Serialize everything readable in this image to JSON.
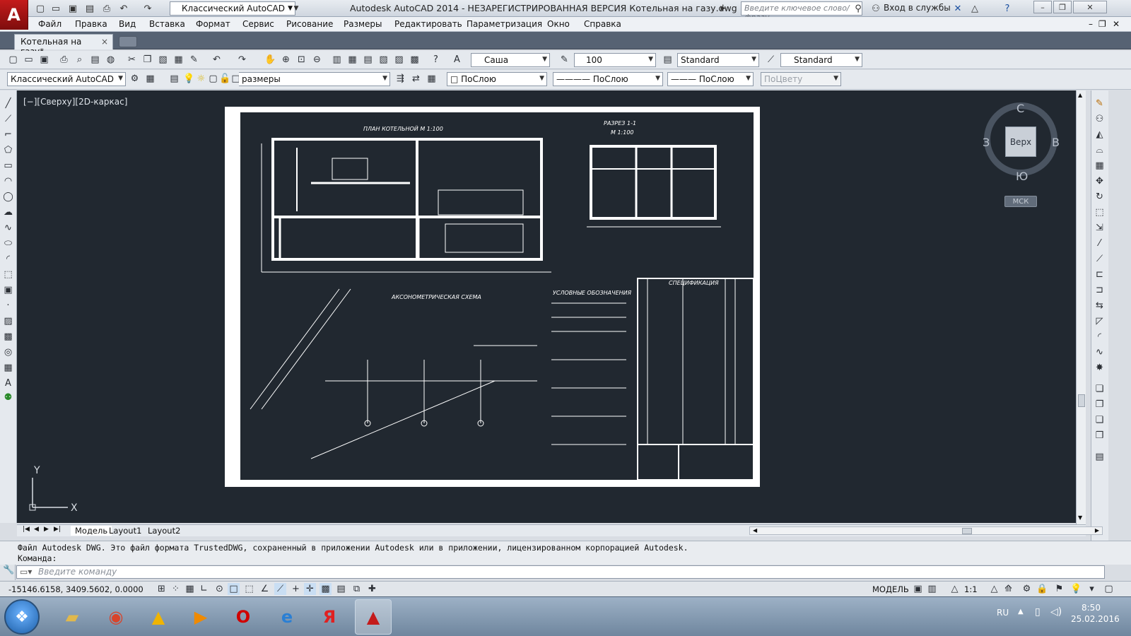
{
  "app": {
    "logo_letter": "A",
    "window_title": "Autodesk AutoCAD 2014 - НЕЗАРЕГИСТРИРОВАННАЯ ВЕРСИЯ    Котельная на газу.dwg",
    "workspace": "Классический AutoCAD",
    "search_placeholder": "Введите ключевое слово/фразу",
    "login": "Вход в службы"
  },
  "menus": [
    "Файл",
    "Правка",
    "Вид",
    "Вставка",
    "Формат",
    "Сервис",
    "Рисование",
    "Размеры",
    "Редактировать",
    "Параметризация",
    "Окно",
    "Справка"
  ],
  "doc_tab": {
    "label": "Котельная на газу*",
    "close": "×"
  },
  "toolbar1": {
    "text_style": "Саша",
    "dim_value": "100",
    "dim_style": "Standard",
    "table_style": "Standard"
  },
  "toolbar2": {
    "workspace": "Классический AutoCAD",
    "layer": "размеры",
    "color": "ПоСлою",
    "linetype": "ПоСлою",
    "lineweight": "ПоСлою",
    "plotstyle": "ПоЦвету"
  },
  "viewport": {
    "label": "[−][Сверху][2D-каркас]",
    "cube_face": "Верх",
    "north": "С",
    "east": "В",
    "south": "Ю",
    "west": "З",
    "ucs_button": "МСК",
    "axis_y": "Y",
    "axis_x": "X"
  },
  "drawing": {
    "plan_title": "ПЛАН КОТЕЛЬНОЙ   М 1:100",
    "section_title": "РАЗРЕЗ 1-1",
    "section_scale": "М 1:100",
    "axo_title": "АКСОНОМЕТРИЧЕСКАЯ СХЕМА",
    "legend_title": "УСЛОВНЫЕ ОБОЗНАЧЕНИЯ",
    "spec_title": "СПЕЦИФИКАЦИЯ"
  },
  "layout_tabs": [
    "Модель",
    "Layout1",
    "Layout2"
  ],
  "command": {
    "history_line1": "Файл Autodesk DWG. Это файл формата TrustedDWG, сохраненный в приложении Autodesk или в приложении, лицензированном корпорацией Autodesk.",
    "history_line2": "Команда:",
    "input_placeholder": "Введите команду"
  },
  "status": {
    "coords": "-15146.6158, 3409.5602, 0.0000",
    "model": "МОДЕЛЬ",
    "scale": "1:1"
  },
  "taskbar": {
    "lang": "RU",
    "time": "8:50",
    "date": "25.02.2016"
  },
  "colors": {
    "canvas": "#212830",
    "sheet": "#ffffff",
    "accent": "#c41b1b"
  }
}
